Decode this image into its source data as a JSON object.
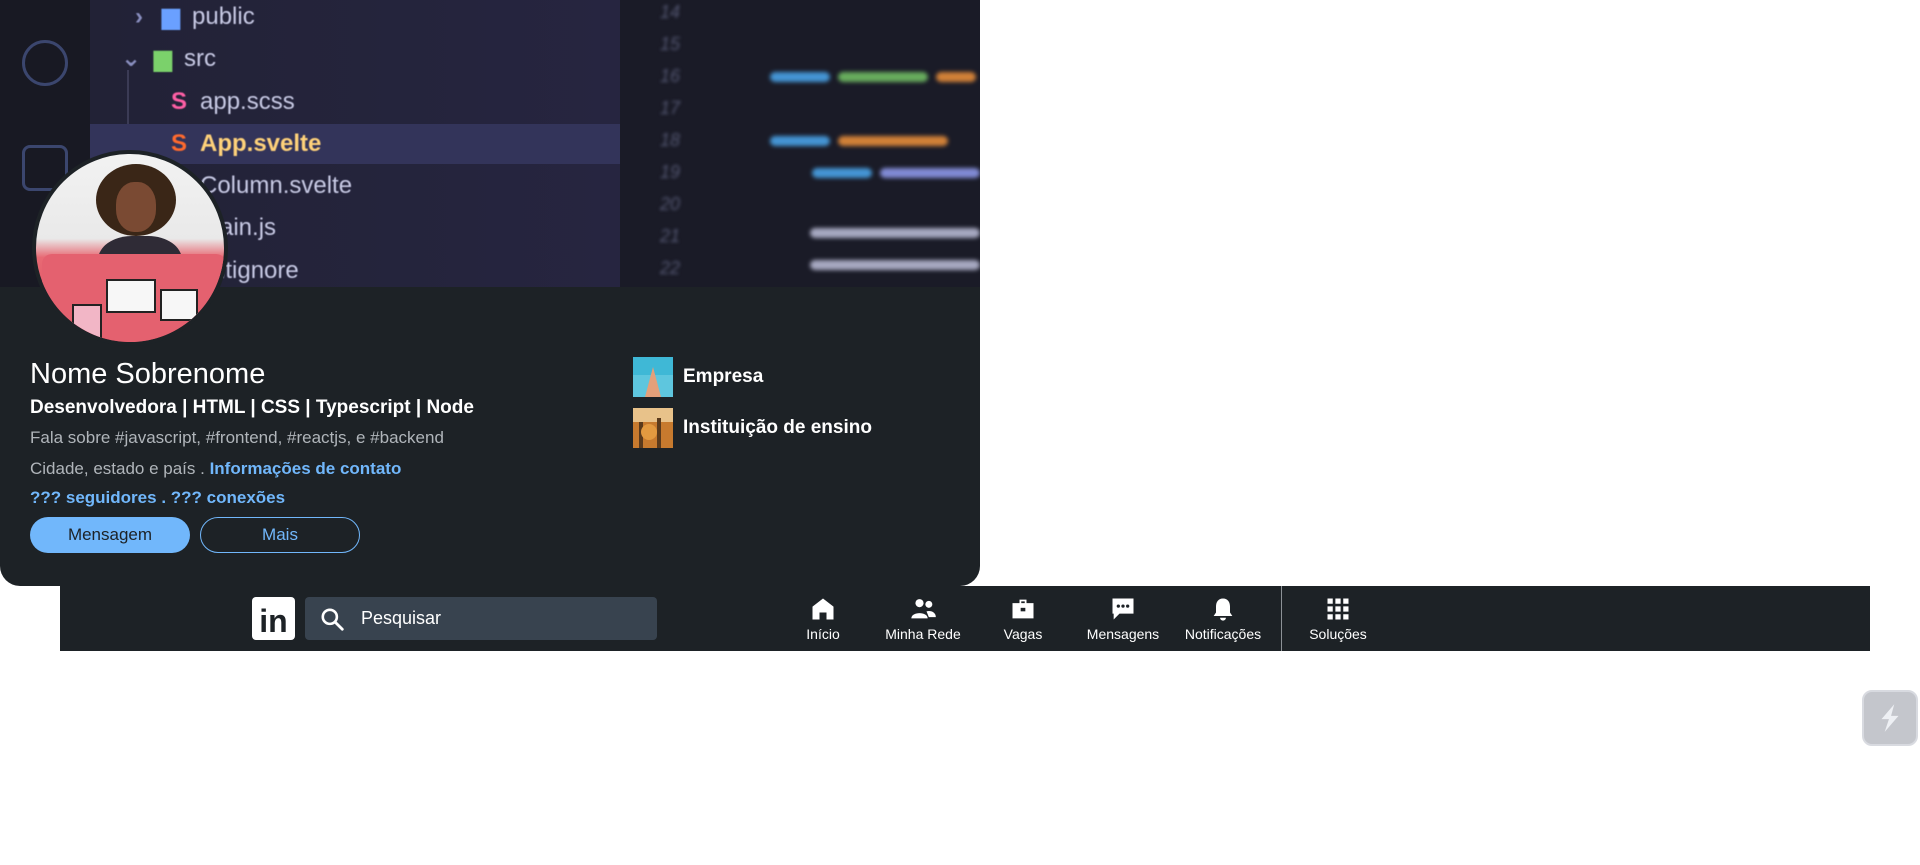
{
  "cover": {
    "files": [
      {
        "label": "public",
        "icon": "folder-icon"
      },
      {
        "label": "src",
        "icon": "folder-open-icon"
      },
      {
        "label": "app.scss",
        "icon": "sass-file-icon"
      },
      {
        "label": "App.svelte",
        "icon": "svelte-file-icon"
      },
      {
        "label": "Column.svelte",
        "icon": "svelte-file-icon"
      },
      {
        "label": "main.js",
        "icon": "js-file-icon"
      },
      {
        "label": ".gitignore",
        "icon": "git-file-icon"
      }
    ],
    "line_numbers": [
      "14",
      "15",
      "16",
      "17",
      "18",
      "19",
      "20",
      "21",
      "22"
    ]
  },
  "profile": {
    "name": "Nome Sobrenome",
    "headline": "Desenvolvedora | HTML | CSS | Typescript | Node",
    "about": "Fala sobre #javascript, #frontend, #reactjs, e #backend",
    "location": "Cidade, estado e país .",
    "contact_link": "Informações de contato",
    "followers": "??? seguidores",
    "separator": ".",
    "connections": "??? conexões",
    "message_button": "Mensagem",
    "more_button": "Mais",
    "company": "Empresa",
    "school": "Instituição de ensino"
  },
  "navbar": {
    "logo": "in",
    "search_placeholder": "Pesquisar",
    "items": [
      {
        "label": "Início",
        "icon": "home-icon"
      },
      {
        "label": "Minha Rede",
        "icon": "people-icon"
      },
      {
        "label": "Vagas",
        "icon": "briefcase-icon"
      },
      {
        "label": "Mensagens",
        "icon": "chat-icon"
      },
      {
        "label": "Notificações",
        "icon": "bell-icon"
      },
      {
        "label": "Soluções",
        "icon": "grid-icon"
      }
    ]
  },
  "colors": {
    "card_bg": "#1d2226",
    "accent": "#71b7fb",
    "search_bg": "#38434f"
  }
}
